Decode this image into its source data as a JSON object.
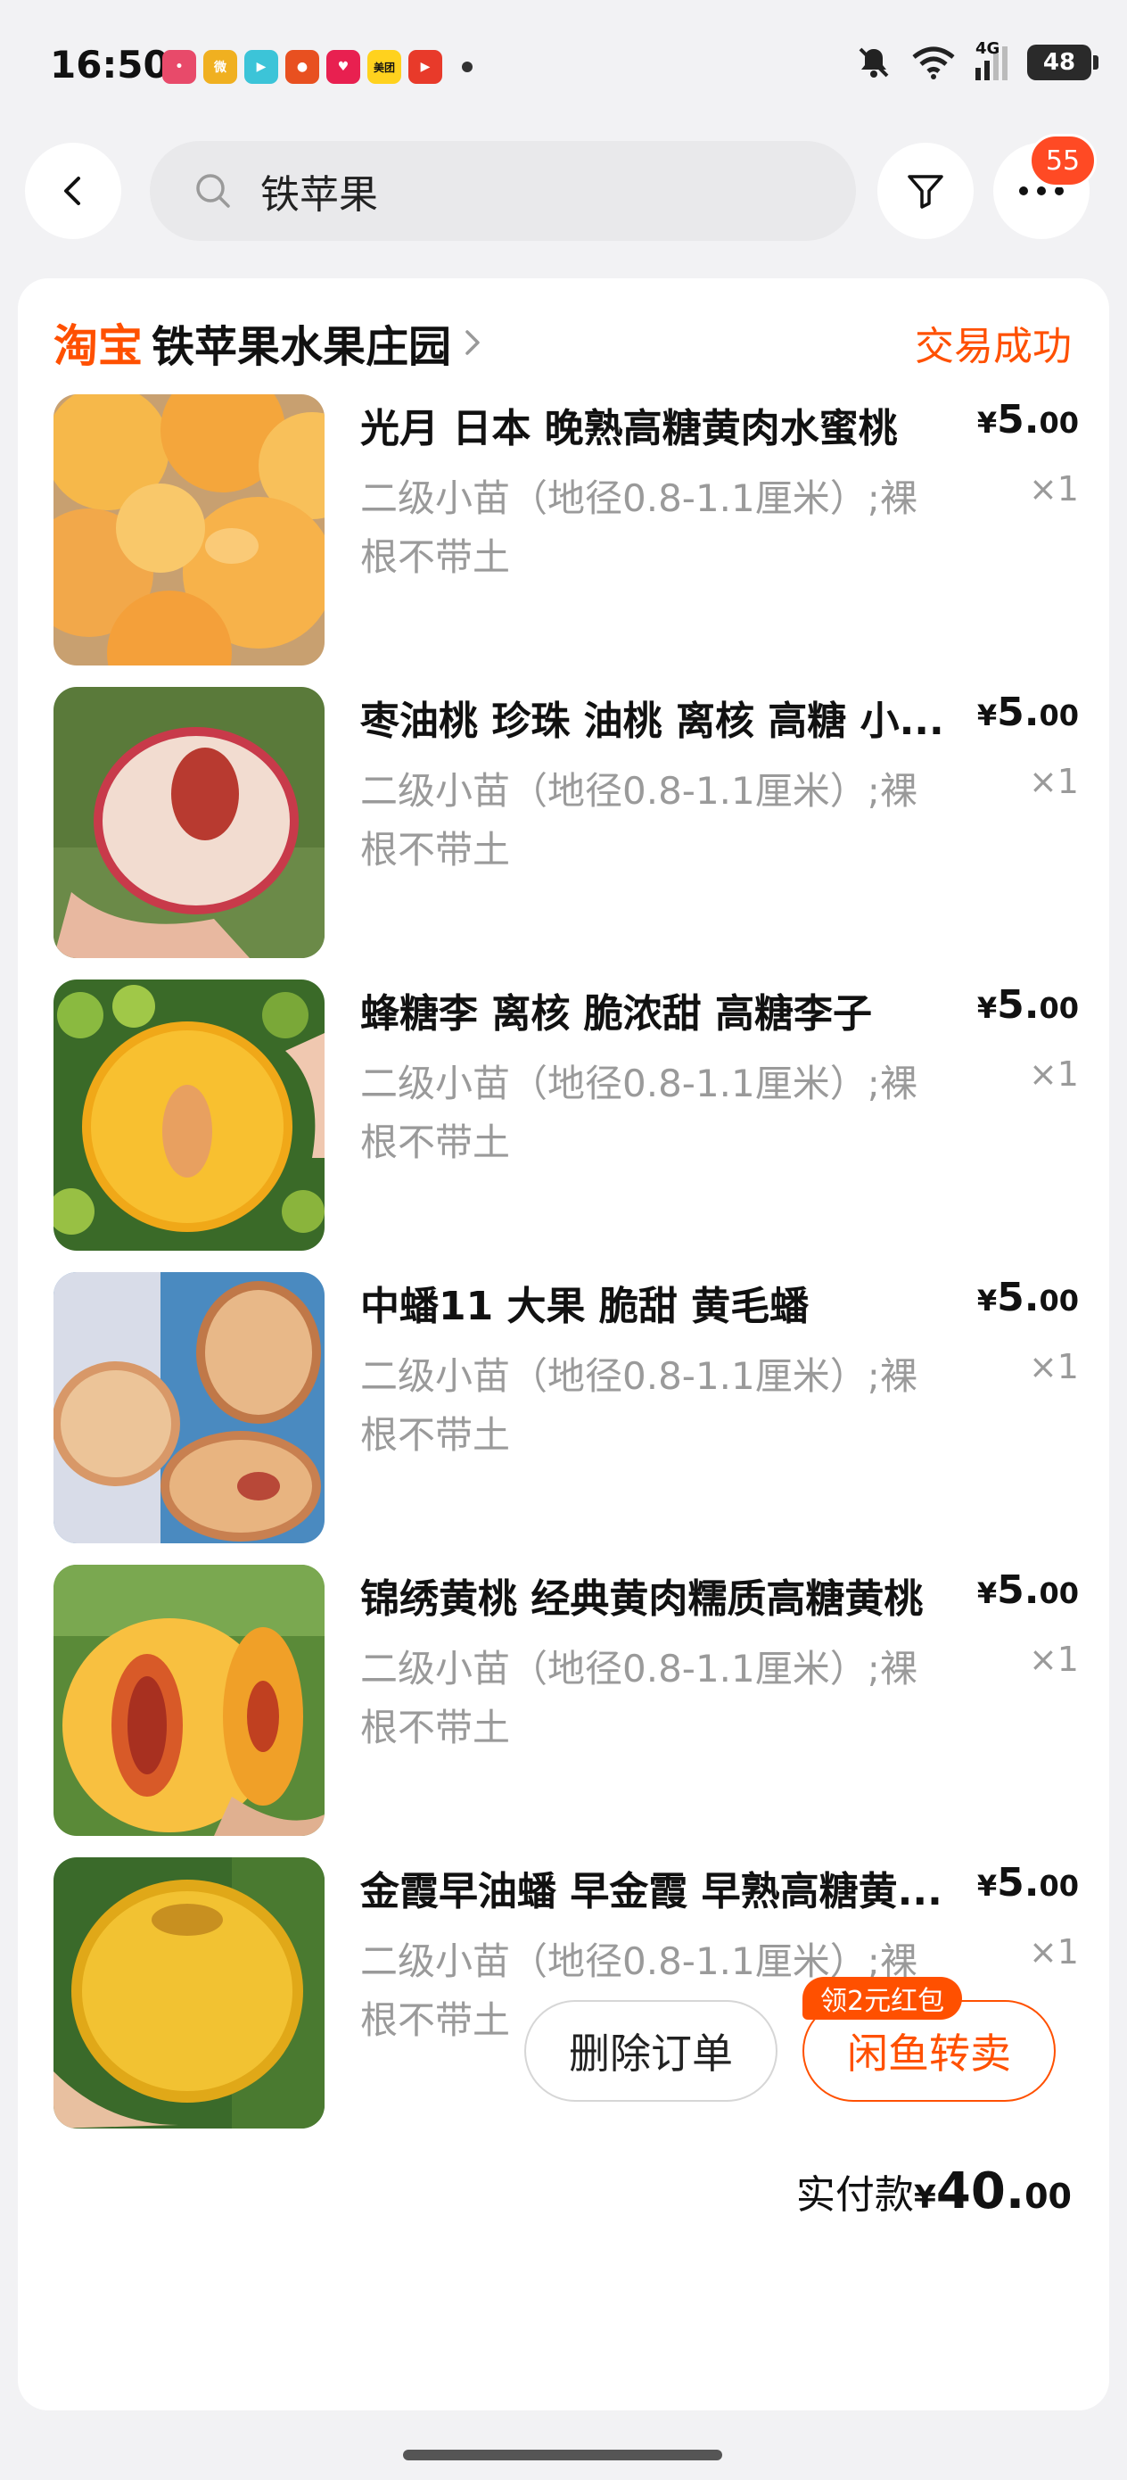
{
  "status_bar": {
    "time": "16:50",
    "app_icons": [
      {
        "name": "app-icon-red",
        "color": "#e84a6a",
        "label": "•"
      },
      {
        "name": "weibo-icon",
        "color": "#f0b020",
        "label": "微"
      },
      {
        "name": "video-app-icon",
        "color": "#3cc4d8",
        "label": "▶"
      },
      {
        "name": "game-app-icon",
        "color": "#e85020",
        "label": "●"
      },
      {
        "name": "heart-app-icon",
        "color": "#e82050",
        "label": "♥"
      },
      {
        "name": "meituan-icon",
        "color": "#ffd21e",
        "label": "美团"
      },
      {
        "name": "play-app-icon",
        "color": "#e83a2a",
        "label": "▶"
      }
    ],
    "network": "4G",
    "battery": "48"
  },
  "search": {
    "query": "铁苹果"
  },
  "more_badge": "55",
  "order": {
    "platform_logo": "淘宝",
    "shop_name": "铁苹果水果庄园",
    "status": "交易成功",
    "items": [
      {
        "title": "光月 日本 晚熟高糖黄肉水蜜桃",
        "spec_line1": "二级小苗（地径0.8-1.1厘米）;裸",
        "spec_line2": "根不带土",
        "currency": "¥",
        "price_int": "5.",
        "price_dec": "00",
        "qty": "×1",
        "image": "yellow-peaches-pile"
      },
      {
        "title": "枣油桃 珍珠 油桃  离核 高糖 小...",
        "spec_line1": "二级小苗（地径0.8-1.1厘米）;裸",
        "spec_line2": "根不带土",
        "currency": "¥",
        "price_int": "5.",
        "price_dec": "00",
        "qty": "×1",
        "image": "halved-nectarine-in-hand"
      },
      {
        "title": "蜂糖李  离核 脆浓甜 高糖李子",
        "spec_line1": "二级小苗（地径0.8-1.1厘米）;裸",
        "spec_line2": "根不带土",
        "currency": "¥",
        "price_int": "5.",
        "price_dec": "00",
        "qty": "×1",
        "image": "halved-yellow-plum"
      },
      {
        "title": "中蟠11  大果 脆甜 黄毛蟠",
        "spec_line1": "二级小苗（地径0.8-1.1厘米）;裸",
        "spec_line2": "根不带土",
        "currency": "¥",
        "price_int": "5.",
        "price_dec": "00",
        "qty": "×1",
        "image": "flat-peach-halves"
      },
      {
        "title": "锦绣黄桃  经典黄肉糯质高糖黄桃",
        "spec_line1": "二级小苗（地径0.8-1.1厘米）;裸",
        "spec_line2": "根不带土",
        "currency": "¥",
        "price_int": "5.",
        "price_dec": "00",
        "qty": "×1",
        "image": "cut-yellow-peach"
      },
      {
        "title": "金霞早油蟠 早金霞  早熟高糖黄...",
        "spec_line1": "二级小苗（地径0.8-1.1厘米）;裸",
        "spec_line2": "根不带土",
        "currency": "¥",
        "price_int": "5.",
        "price_dec": "00",
        "qty": "×1",
        "image": "golden-flat-nectarine"
      }
    ],
    "total": {
      "label": "实付款",
      "currency": "¥",
      "amount_int": "40.",
      "amount_dec": "00"
    },
    "buttons": {
      "delete": "删除订单",
      "resell": "闲鱼转卖",
      "promo_tag": "领2元红包"
    }
  },
  "colors": {
    "accent": "#ff5000",
    "badge": "#ff4a24",
    "muted_text": "#9a9a9a"
  }
}
